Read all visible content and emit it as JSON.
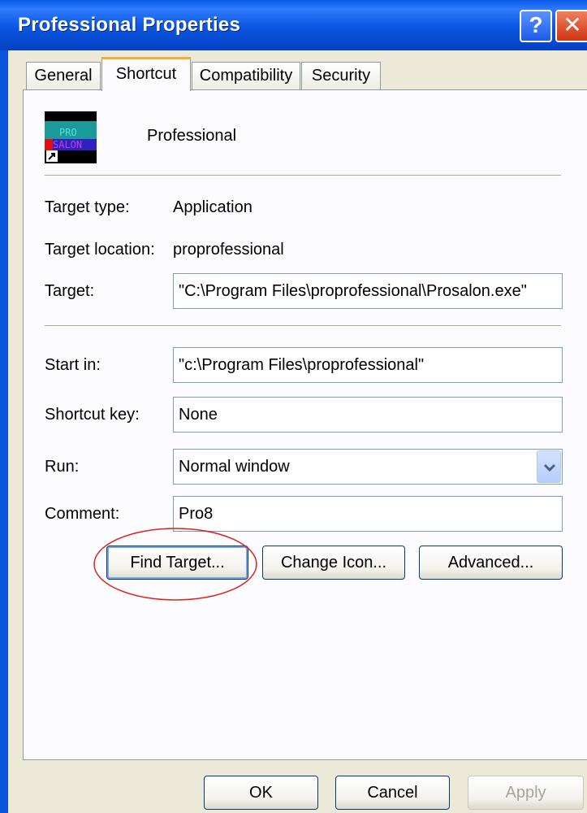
{
  "window": {
    "title": "Professional Properties",
    "help_glyph": "?",
    "close_glyph": "✕"
  },
  "tabs": [
    {
      "label": "General"
    },
    {
      "label": "Shortcut",
      "active": true
    },
    {
      "label": "Compatibility"
    },
    {
      "label": "Security"
    }
  ],
  "shortcut": {
    "name": "Professional",
    "icon_text_line1": "PRO",
    "icon_text_line2": "SALON",
    "target_type_label": "Target type:",
    "target_type_value": "Application",
    "target_location_label": "Target location:",
    "target_location_value": "proprofessional",
    "target_label": "Target:",
    "target_value": "\"C:\\Program Files\\proprofessional\\Prosalon.exe\"",
    "start_in_label": "Start in:",
    "start_in_value": "\"c:\\Program Files\\proprofessional\"",
    "shortcut_key_label": "Shortcut key:",
    "shortcut_key_value": "None",
    "run_label": "Run:",
    "run_value": "Normal window",
    "comment_label": "Comment:",
    "comment_value": "Pro8"
  },
  "buttons": {
    "find_target": "Find Target...",
    "change_icon": "Change Icon...",
    "advanced": "Advanced...",
    "ok": "OK",
    "cancel": "Cancel",
    "apply": "Apply"
  },
  "colors": {
    "titlebar": "#0A5BE8",
    "annotation_circle": "#E02020",
    "tab_highlight": "#F7B036"
  }
}
